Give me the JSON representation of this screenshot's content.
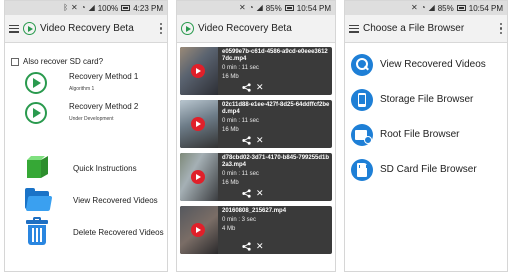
{
  "panels": [
    {
      "status": {
        "time": "4:23 PM",
        "battery": "100%"
      },
      "app_title": "Video Recovery Beta",
      "also_recover_sd": "Also recover SD card?",
      "methods": [
        {
          "title": "Recovery Method 1",
          "subtitle": "Algorithm 1"
        },
        {
          "title": "Recovery Method 2",
          "subtitle": "Under Development"
        }
      ],
      "features": [
        {
          "label": "Quick Instructions",
          "icon": "cube-icon"
        },
        {
          "label": "View Recovered Videos",
          "icon": "folder-icon"
        },
        {
          "label": "Delete Recovered Videos",
          "icon": "trash-icon"
        }
      ]
    },
    {
      "status": {
        "time": "10:54 PM",
        "battery": "85%"
      },
      "app_title": "Video Recovery Beta",
      "videos": [
        {
          "name": "e0599e7b-c61d-4586-a9cd-e0eee36127dc.mp4",
          "duration": "0 min : 11 sec",
          "size": "16 Mb"
        },
        {
          "name": "02c11d88-e1ee-427f-8d25-64ddffcf2bed.mp4",
          "duration": "0 min : 11 sec",
          "size": "16 Mb"
        },
        {
          "name": "d78cbd02-3d71-4170-b845-799255d1b2a3.mp4",
          "duration": "0 min : 11 sec",
          "size": "16 Mb"
        },
        {
          "name": "20160808_215627.mp4",
          "duration": "0 min : 3 sec",
          "size": "4 Mb"
        }
      ]
    },
    {
      "status": {
        "time": "10:54 PM",
        "battery": "85%"
      },
      "app_title": "Choose a File Browser",
      "choices": [
        {
          "label": "View Recovered Videos",
          "icon": "search-icon"
        },
        {
          "label": "Storage File Browser",
          "icon": "phone-icon"
        },
        {
          "label": "Root File Browser",
          "icon": "folder-icon"
        },
        {
          "label": "SD Card File Browser",
          "icon": "sd-card-icon"
        }
      ]
    }
  ],
  "colors": {
    "accent_green": "#2a9a4e",
    "accent_blue": "#1e7fd6",
    "play_red": "#e0202a",
    "item_dark": "#3a3a3a"
  }
}
